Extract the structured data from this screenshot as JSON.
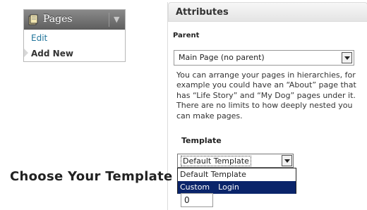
{
  "pages_menu": {
    "title": "Pages",
    "icon": "pages-icon",
    "toggle_icon": "triangle-down-icon",
    "items": [
      {
        "label": "Edit"
      },
      {
        "label": "Add New"
      }
    ]
  },
  "attributes": {
    "title": "Attributes",
    "parent_label": "Parent",
    "parent_value": "Main Page (no parent)",
    "help_text": "You can arrange your pages in hierarchies, for example you could have an “About” page that has “Life Story” and “My Dog” pages under it. There are no limits to how deeply nested you can make pages.",
    "template_label": "Template",
    "template_value": "Default Template",
    "template_options": [
      "Default Template",
      "Custom",
      "Login"
    ],
    "order_value": "0"
  },
  "caption": "Choose Your Template",
  "colors": {
    "link": "#21759b",
    "highlight": "#0a246a"
  }
}
